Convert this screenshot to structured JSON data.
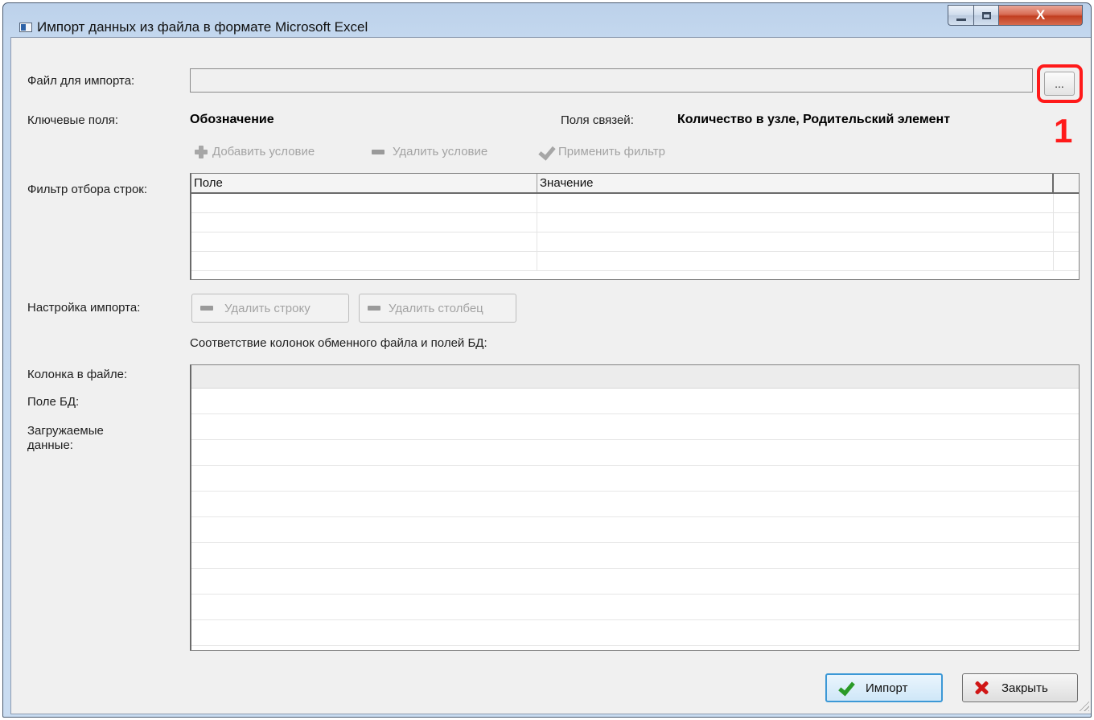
{
  "window": {
    "title": "Импорт данных из файла в формате Microsoft Excel",
    "controls": {
      "close_glyph": "X"
    }
  },
  "file_import": {
    "label": "Файл для импорта:",
    "value": "",
    "browse_label": "..."
  },
  "key_fields": {
    "label": "Ключевые поля:",
    "value": "Обозначение"
  },
  "link_fields": {
    "label": "Поля связей:",
    "value": "Количество в узле, Родительский элемент"
  },
  "annotation": {
    "marker": "1",
    "color": "#ff1a1a"
  },
  "filter_toolbar": {
    "add_condition": "Добавить условие",
    "remove_condition": "Удалить условие",
    "apply_filter": "Применить фильтр"
  },
  "row_filter": {
    "label": "Фильтр отбора строк:",
    "columns": [
      "Поле",
      "Значение"
    ]
  },
  "import_settings": {
    "label": "Настройка импорта:",
    "delete_row": "Удалить строку",
    "delete_column": "Удалить столбец",
    "mapping_caption": "Соответствие колонок обменного файла и полей БД:"
  },
  "mapping_labels": {
    "file_column": "Колонка в файле:",
    "db_field": "Поле БД:",
    "loaded_data_line1": "Загружаемые",
    "loaded_data_line2": "данные:"
  },
  "footer": {
    "import_label": "Импорт",
    "close_label": "Закрыть"
  },
  "colors": {
    "accent": "#3c98d6",
    "ok": "#2a9a28",
    "cancel": "#d01616",
    "window_close": "#c13e20"
  }
}
